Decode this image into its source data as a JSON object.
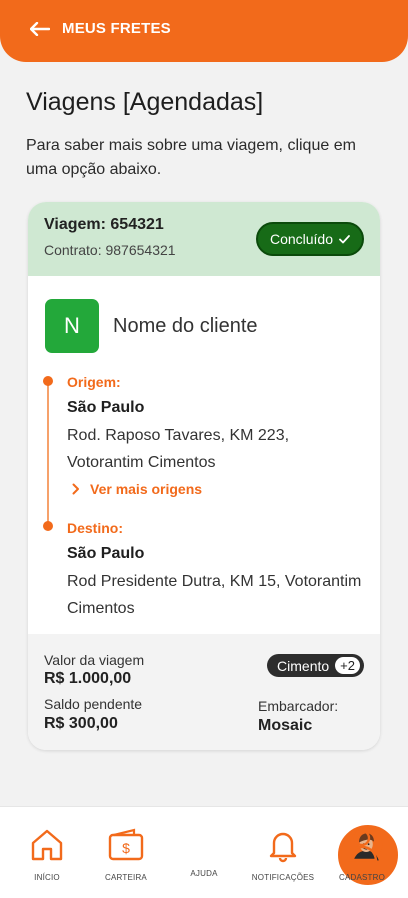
{
  "header": {
    "back_label": "MEUS FRETES"
  },
  "page": {
    "title": "Viagens [Agendadas]",
    "subtitle": "Para saber mais sobre uma viagem, clique em uma opção abaixo."
  },
  "trip": {
    "trip_id": "Viagem: 654321",
    "contract": "Contrato: 987654321",
    "status": "Concluído",
    "client_initial": "N",
    "client_name": "Nome do cliente",
    "origin_label": "Origem:",
    "origin_city": "São Paulo",
    "origin_address": "Rod. Raposo Tavares, KM 223, Votorantim Cimentos",
    "more_origins": "Ver mais origens",
    "destination_label": "Destino:",
    "destination_city": "São Paulo",
    "destination_address": "Rod Presidente Dutra, KM 15, Votorantim Cimentos",
    "trip_value_label": "Valor da viagem",
    "trip_value": "R$ 1.000,00",
    "pending_label": "Saldo pendente",
    "pending_value": "R$ 300,00",
    "cargo": "Cimento",
    "cargo_more": "+2",
    "shipper_label": "Embarcador:",
    "shipper": "Mosaic"
  },
  "nav": {
    "items": [
      {
        "label": "INÍCIO",
        "icon": "home-icon"
      },
      {
        "label": "CARTEIRA",
        "icon": "wallet-icon"
      },
      {
        "label": "AJUDA",
        "icon": "help-avatar"
      },
      {
        "label": "NOTIFICAÇÕES",
        "icon": "bell-icon"
      },
      {
        "label": "CADASTRO",
        "icon": "user-icon"
      }
    ]
  },
  "colors": {
    "brand_orange": "#f26a1b",
    "status_green": "#176b17",
    "card_head_green": "#cfe8d2",
    "avatar_green": "#23a83a"
  }
}
